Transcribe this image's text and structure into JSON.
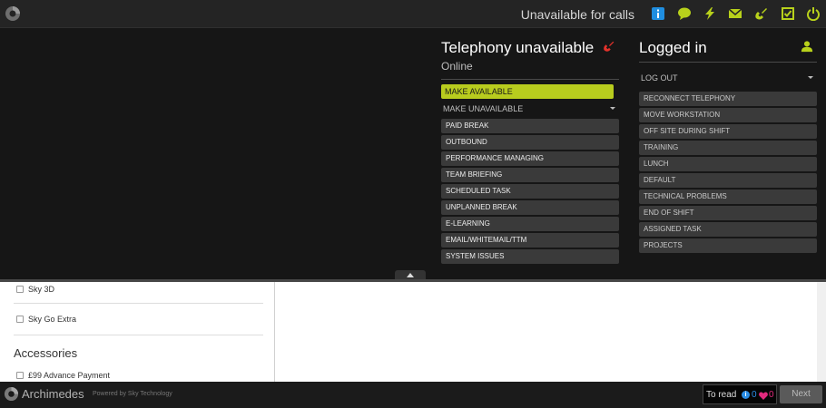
{
  "topbar": {
    "status": "Unavailable for calls",
    "icons": [
      "info-icon",
      "chat-icon",
      "lightning-icon",
      "mail-icon",
      "phone-icon",
      "checkbox-icon",
      "power-icon"
    ],
    "colors": {
      "accent": "#b8d11b",
      "info": "#1f8ee0"
    }
  },
  "telephony": {
    "title": "Telephony unavailable",
    "status": "Online",
    "make_available": "MAKE AVAILABLE",
    "make_unavailable": "MAKE UNAVAILABLE",
    "reasons": [
      "PAID BREAK",
      "OUTBOUND",
      "PERFORMANCE MANAGING",
      "TEAM BRIEFING",
      "SCHEDULED TASK",
      "UNPLANNED BREAK",
      "E-LEARNING",
      "EMAIL/WHITEMAIL/TTM",
      "SYSTEM ISSUES"
    ]
  },
  "login": {
    "title": "Logged in",
    "log_out": "LOG OUT",
    "reasons": [
      "RECONNECT TELEPHONY",
      "MOVE WORKSTATION",
      "OFF SITE DURING SHIFT",
      "TRAINING",
      "LUNCH",
      "DEFAULT",
      "TECHNICAL PROBLEMS",
      "END OF SHIFT",
      "ASSIGNED TASK",
      "PROJECTS"
    ]
  },
  "content": {
    "checkbox_1": "Sky 3D",
    "checkbox_2": "Sky Go Extra",
    "accessories_heading": "Accessories",
    "checkbox_3": "£99 Advance Payment"
  },
  "footer": {
    "brand": "Archimedes",
    "powered_by": "Powered by Sky Technology",
    "to_read": "To read",
    "info_count": "0",
    "heart_count": "0",
    "next": "Next"
  }
}
